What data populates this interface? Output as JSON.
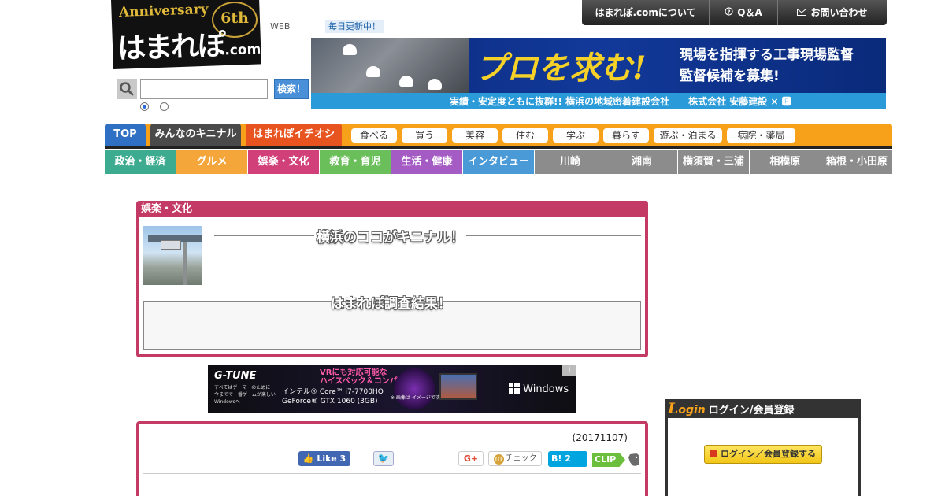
{
  "logo": {
    "anniversary": "Anniversary",
    "sixth": "6th",
    "brand": "はまれぽ",
    "domain": ".com"
  },
  "search": {
    "web_label": "WEB",
    "update_badge": "毎日更新中！",
    "input_value": "",
    "button_label": "検索！"
  },
  "top_links": [
    {
      "label": "はまれぽ.comについて",
      "icon": ""
    },
    {
      "label": "Q＆A",
      "icon": "question-icon"
    },
    {
      "label": "お問い合わせ",
      "icon": "mail-icon"
    }
  ],
  "header_banner": {
    "headline": "プロを求む!",
    "line1": "現場を指揮する工事現場監督",
    "line2": "監督候補を募集!",
    "tagline": "実績・安定度ともに抜群!! 横浜の地域密着建設会社　　株式会社 安藤建設 × 🅿"
  },
  "nav_primary": {
    "top": "TOP",
    "kininal": "みんなのキニナル",
    "ichioshi": "はまれぽイチオシ",
    "pills": [
      "食べる",
      "買う",
      "美容",
      "住む",
      "学ぶ",
      "暮らす",
      "遊ぶ・泊まる",
      "病院・薬局"
    ]
  },
  "nav_categories": [
    {
      "label": "政治・経済",
      "color": "#3dab8f"
    },
    {
      "label": "グルメ",
      "color": "#f4a63a"
    },
    {
      "label": "娯楽・文化",
      "color": "#d2407a"
    },
    {
      "label": "教育・育児",
      "color": "#6bbf5a"
    },
    {
      "label": "生活・健康",
      "color": "#a55bc4"
    },
    {
      "label": "インタビュー",
      "color": "#4a9ad8"
    },
    {
      "label": "川崎",
      "color": "#8c8c8c"
    },
    {
      "label": "湘南",
      "color": "#8c8c8c"
    },
    {
      "label": "横須賀・三浦",
      "color": "#8c8c8c"
    },
    {
      "label": "相模原",
      "color": "#8c8c8c"
    },
    {
      "label": "箱根・小田原",
      "color": "#8c8c8c"
    }
  ],
  "panel": {
    "category": "娯楽・文化",
    "kininal_heading": "横浜のココがキニナル！",
    "results_heading": "はまれぽ調査結果！"
  },
  "ad": {
    "brand": "G-TUNE",
    "copy": "すべてはゲーマーのために　今までで一番ゲームが楽しい Windowsへ",
    "vr": "VRにも対応可能な",
    "vr2": "ハイスペック＆コンパクト",
    "cpu": "インテル® Core™ i7-7700HQ",
    "gpu": "GeForce® GTX 1060 (3GB)",
    "note": "※ 画像は イメージです。",
    "windows": "Windows",
    "info": "i"
  },
  "article": {
    "date": "＿ (20171107)",
    "like_label": "Like",
    "like_count": "3",
    "gplus_label": "G+",
    "mixi_label": "チェック",
    "hatena_label": "B!",
    "hatena_count": "2",
    "clip_label": "CLIP"
  },
  "login": {
    "login_word": "ogin",
    "title": "ログイン/会員登録",
    "button_label": "ログイン／会員登録する"
  },
  "colors": {
    "brand_pink": "#c33a65",
    "nav_orange": "#f7a11a",
    "top_blue": "#2f6fc4"
  }
}
